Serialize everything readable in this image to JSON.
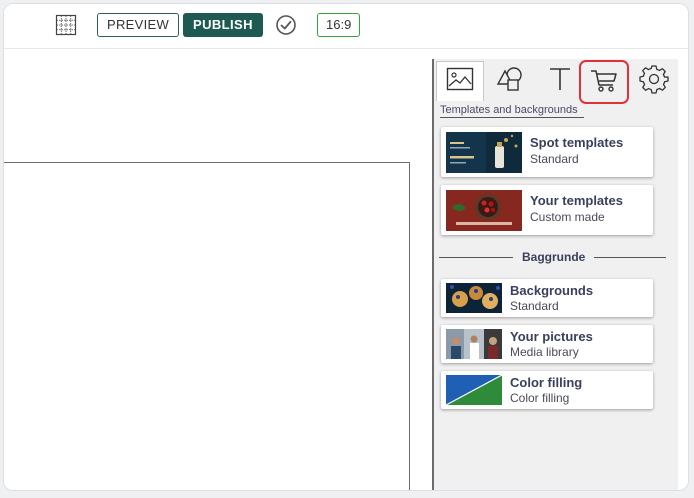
{
  "toolbar": {
    "grid_icon": "grid-icon",
    "preview_label": "PREVIEW",
    "publish_label": "PUBLISH",
    "check_icon": "check-circle-icon",
    "ratio_label": "16:9"
  },
  "panel": {
    "tabs": [
      {
        "icon": "image-icon"
      },
      {
        "icon": "shapes-icon"
      },
      {
        "icon": "text-icon"
      },
      {
        "icon": "cart-icon"
      },
      {
        "icon": "gear-icon"
      }
    ],
    "caption": "Templates and backgrounds",
    "templates": [
      {
        "title": "Spot templates",
        "subtitle": "Standard"
      },
      {
        "title": "Your templates",
        "subtitle": "Custom made"
      }
    ],
    "section_label": "Baggrunde",
    "backgrounds": [
      {
        "title": "Backgrounds",
        "subtitle": "Standard"
      },
      {
        "title": "Your pictures",
        "subtitle": "Media library"
      },
      {
        "title": "Color filling",
        "subtitle": "Color filling"
      }
    ]
  },
  "colors": {
    "publish": "#1e5a52",
    "ratio_border": "#35a33a",
    "highlight": "#e0313a",
    "color_fill_blue": "#1f5fb4",
    "color_fill_green": "#2e8b3a"
  }
}
